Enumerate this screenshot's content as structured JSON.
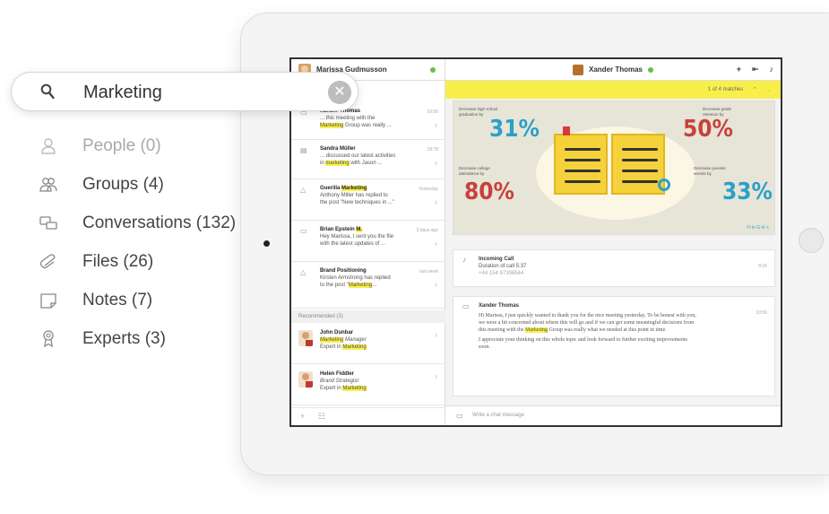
{
  "search": {
    "value": "Marketing"
  },
  "categories": [
    {
      "label": "People (0)",
      "icon": "person-icon",
      "dim": true
    },
    {
      "label": "Groups (4)",
      "icon": "group-icon",
      "dim": false
    },
    {
      "label": "Conversations (132)",
      "icon": "conversations-icon",
      "dim": false
    },
    {
      "label": "Files (26)",
      "icon": "paperclip-icon",
      "dim": false
    },
    {
      "label": "Notes (7)",
      "icon": "note-icon",
      "dim": false
    },
    {
      "label": "Experts (3)",
      "icon": "expert-icon",
      "dim": false
    }
  ],
  "app": {
    "user_name": "Marissa Gudmusson",
    "messages": [
      {
        "sender": "Xander Thomas",
        "line1": "... this meeting with the",
        "hl": "Marketing",
        "rest": " Group was really ...",
        "time": "10:56"
      },
      {
        "sender": "Sandra Müller",
        "line1": "... discussed our latest activities",
        "pre": "in ",
        "hl": "marketing",
        "rest": " with Jason ...",
        "time": "18:78"
      },
      {
        "sender_pre": "Guerilla ",
        "sender_hl": "Marketing",
        "line1": "Anthony Miller has replied to",
        "line2": "the post \"New techniques in ...\"",
        "time": "Yesterday"
      },
      {
        "sender": "Brian Epstein",
        "sender_tag": "M.",
        "line1": "Hey Marissa, I sent you the file",
        "line2": "with the latest updates of ...",
        "time": "3 days ago"
      },
      {
        "sender": "Brand Positioning",
        "line1": "Kirsten Armstrong has replied",
        "pre": "to the post \"",
        "hl": "Marketing",
        "rest": "...",
        "time": "last week"
      }
    ],
    "recommended_label": "Recommended (3)",
    "recommended": [
      {
        "name": "John Dunbar",
        "role_hl": "Marketing",
        "role_rest": " Manager",
        "expert_pre": "Expert in ",
        "expert_hl": "Marketing"
      },
      {
        "name": "Helen Fiddler",
        "role": "Brand Strategist",
        "expert_pre": "Expert in ",
        "expert_hl": "Marketing"
      }
    ],
    "conversation_title": "Xander Thomas",
    "match_count": "1 of 4 matches",
    "infographic": {
      "items": [
        {
          "caption": "Decrease high school graduation by",
          "value": "31%"
        },
        {
          "caption": "Decrease college attendance by",
          "value": "80%"
        },
        {
          "caption": "Decrease grade retention by",
          "value": "50%"
        },
        {
          "caption": "Decrease juvenile arrests by",
          "value": "33%"
        }
      ],
      "social": "f  t  in  G  ✉  +"
    },
    "incoming_call": {
      "title": "Incoming Call",
      "duration": "Duration of call 5:37",
      "number": "+44 154 87396544",
      "time": "8:26"
    },
    "message_card": {
      "sender": "Xander Thomas",
      "time": "10:56",
      "para1_a": "Hi Marissa, I just quickly wanted to thank you for the nice meeting yesterday. To be honest with you, we were a bit concerned about where this will go and if we can get some meaningful decisions from this meeting with the",
      "para1_hl": "Marketing",
      "para1_b": " Group was really what we needed at this point in time.",
      "para2": "I appreciate your thinking on this whole topic and look forward to further exciting improvements soon."
    },
    "chat_placeholder": "Write a chat message"
  },
  "colors": {
    "highlight": "#f9ef4b",
    "accent_red": "#c8413a",
    "accent_blue": "#2aa0c9",
    "online": "#6bbd45"
  }
}
